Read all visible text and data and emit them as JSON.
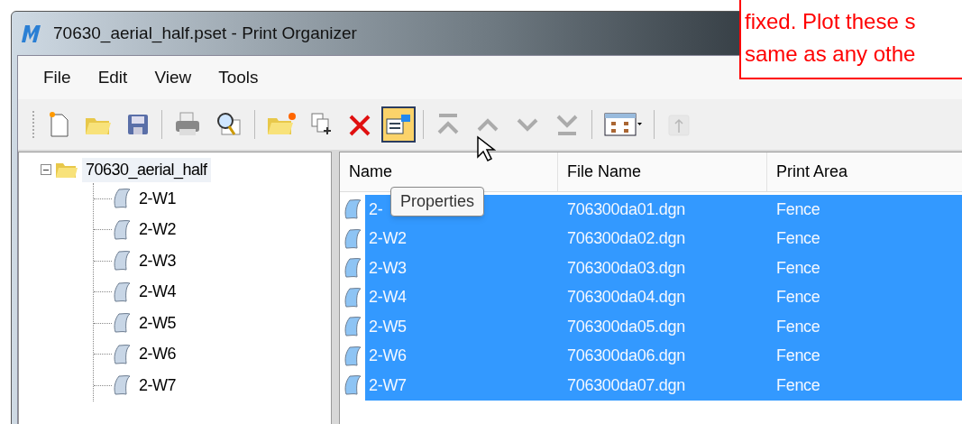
{
  "window": {
    "title": "70630_aerial_half.pset - Print Organizer"
  },
  "annotation": {
    "lines": [
      "fixed. Plot these s",
      "same as any othe"
    ]
  },
  "menu": [
    "File",
    "Edit",
    "View",
    "Tools"
  ],
  "toolbar": [
    {
      "kind": "new",
      "selected": false,
      "disabled": false
    },
    {
      "kind": "open",
      "selected": false,
      "disabled": false
    },
    {
      "kind": "save",
      "selected": false,
      "disabled": false
    },
    {
      "kind": "separator"
    },
    {
      "kind": "print",
      "selected": false,
      "disabled": false
    },
    {
      "kind": "preview",
      "selected": false,
      "disabled": false
    },
    {
      "kind": "separator"
    },
    {
      "kind": "new-folder",
      "selected": false,
      "disabled": false
    },
    {
      "kind": "add-files",
      "selected": false,
      "disabled": false
    },
    {
      "kind": "delete",
      "selected": false,
      "disabled": false
    },
    {
      "kind": "properties",
      "selected": true,
      "disabled": false
    },
    {
      "kind": "separator"
    },
    {
      "kind": "top",
      "selected": false,
      "disabled": true
    },
    {
      "kind": "up",
      "selected": false,
      "disabled": true
    },
    {
      "kind": "down",
      "selected": false,
      "disabled": true
    },
    {
      "kind": "bottom",
      "selected": false,
      "disabled": true
    },
    {
      "kind": "separator"
    },
    {
      "kind": "view",
      "selected": false,
      "disabled": false
    },
    {
      "kind": "separator"
    },
    {
      "kind": "export",
      "selected": false,
      "disabled": true
    }
  ],
  "tooltip": "Properties",
  "tree": {
    "label": "70630_aerial_half",
    "expanded": true,
    "children": [
      {
        "label": "2-W1"
      },
      {
        "label": "2-W2"
      },
      {
        "label": "2-W3"
      },
      {
        "label": "2-W4"
      },
      {
        "label": "2-W5"
      },
      {
        "label": "2-W6"
      },
      {
        "label": "2-W7"
      }
    ]
  },
  "table": {
    "columns": [
      "Name",
      "File Name",
      "Print Area"
    ],
    "rows": [
      {
        "name": "2-",
        "file_name": "706300da01.dgn",
        "print_area": "Fence",
        "selected": true
      },
      {
        "name": "2-W2",
        "file_name": "706300da02.dgn",
        "print_area": "Fence",
        "selected": true
      },
      {
        "name": "2-W3",
        "file_name": "706300da03.dgn",
        "print_area": "Fence",
        "selected": true
      },
      {
        "name": "2-W4",
        "file_name": "706300da04.dgn",
        "print_area": "Fence",
        "selected": true
      },
      {
        "name": "2-W5",
        "file_name": "706300da05.dgn",
        "print_area": "Fence",
        "selected": true
      },
      {
        "name": "2-W6",
        "file_name": "706300da06.dgn",
        "print_area": "Fence",
        "selected": true
      },
      {
        "name": "2-W7",
        "file_name": "706300da07.dgn",
        "print_area": "Fence",
        "selected": true
      }
    ]
  }
}
